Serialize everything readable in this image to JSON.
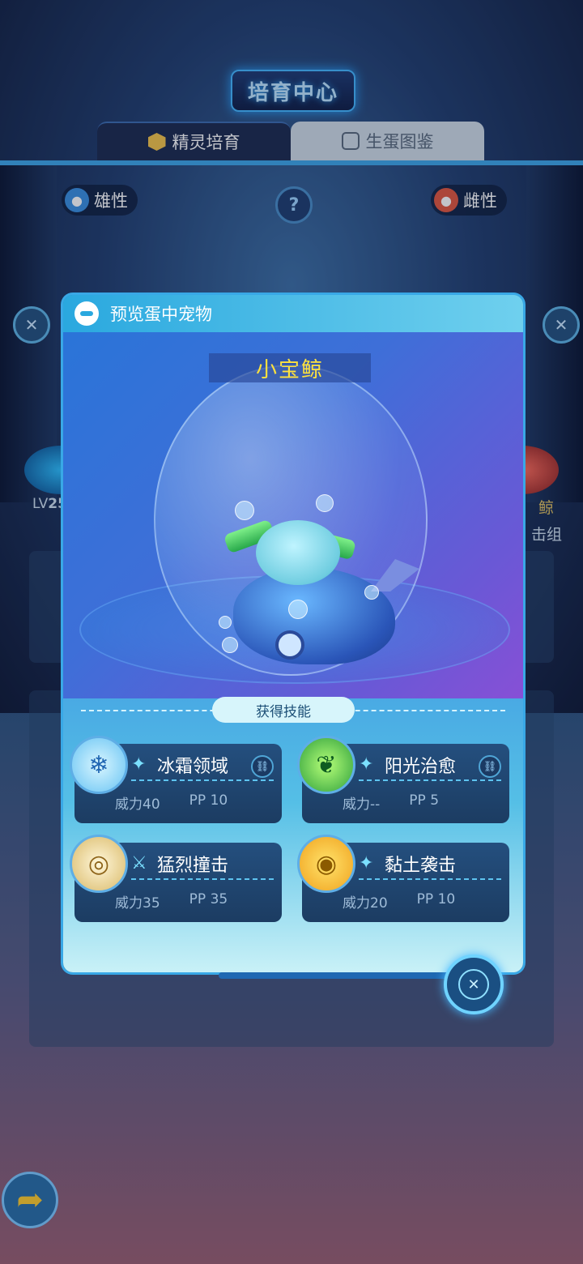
{
  "header": {
    "title": "培育中心"
  },
  "tabs": [
    {
      "label": "精灵培育",
      "active": true,
      "icon": "hexagon-icon"
    },
    {
      "label": "生蛋图鉴",
      "active": false,
      "icon": "book-icon"
    }
  ],
  "gender": {
    "male": "雄性",
    "female": "雌性"
  },
  "help": {
    "label": "?"
  },
  "left_pet": {
    "level_prefix": "LV",
    "level": "25"
  },
  "right_pet": {
    "name_fragment": "鲸",
    "group_fragment": "击组"
  },
  "modal": {
    "title": "预览蛋中宠物",
    "pet_name": "小宝鲸",
    "skills_title": "获得技能",
    "skills": [
      {
        "name": "冰霜领域",
        "type_icon": "sparkle-icon",
        "badge_icon": "snowflake-icon",
        "has_link": true,
        "power_label": "威力",
        "power": "40",
        "pp_label": "PP",
        "pp": "10"
      },
      {
        "name": "阳光治愈",
        "type_icon": "sparkle-icon",
        "badge_icon": "leaf-icon",
        "has_link": true,
        "power_label": "威力",
        "power": "--",
        "pp_label": "PP",
        "pp": "5"
      },
      {
        "name": "猛烈撞击",
        "type_icon": "sword-icon",
        "badge_icon": "shield-icon",
        "has_link": false,
        "power_label": "威力",
        "power": "35",
        "pp_label": "PP",
        "pp": "35"
      },
      {
        "name": "黏土袭击",
        "type_icon": "sparkle-icon",
        "badge_icon": "coin-icon",
        "has_link": false,
        "power_label": "威力",
        "power": "20",
        "pp_label": "PP",
        "pp": "10"
      }
    ]
  },
  "colors": {
    "accent": "#3ea6e8",
    "pet_name": "#ffe23d",
    "back_arrow": "#ffcc2e"
  }
}
